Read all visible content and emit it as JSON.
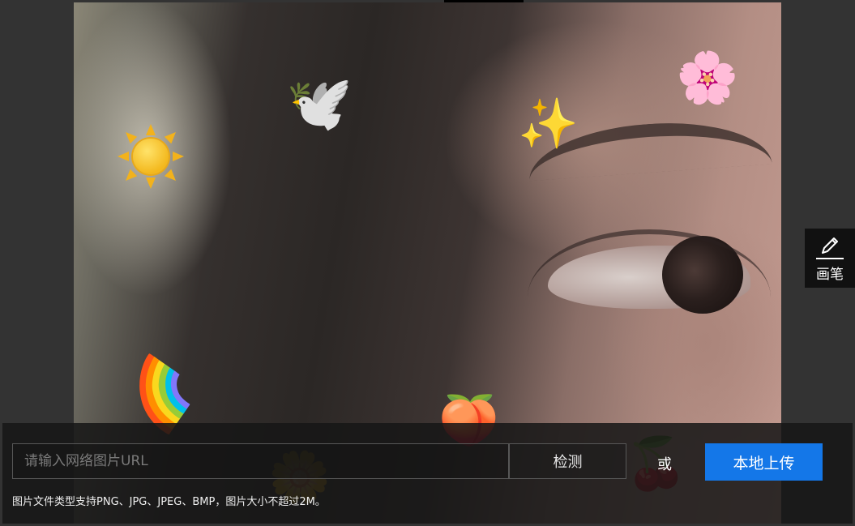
{
  "bottom_bar": {
    "url_placeholder": "请输入网络图片URL",
    "detect_label": "检测",
    "or_label": "或",
    "upload_label": "本地上传",
    "hint": "图片文件类型支持PNG、JPG、JPEG、BMP，图片大小不超过2M。"
  },
  "tools": {
    "pen_label": "画笔",
    "pen_icon": "pencil-icon"
  },
  "stickers": {
    "dove": "🕊️",
    "sparkles": "✨",
    "flower": "🌸",
    "rainbow": "🌈",
    "peach": "🍑",
    "sunflower": "🌼",
    "cherries": "🍒"
  },
  "colors": {
    "background": "#333333",
    "upload_button": "#1477e8",
    "bottom_bar": "#161616",
    "pen_panel": "#111111"
  }
}
